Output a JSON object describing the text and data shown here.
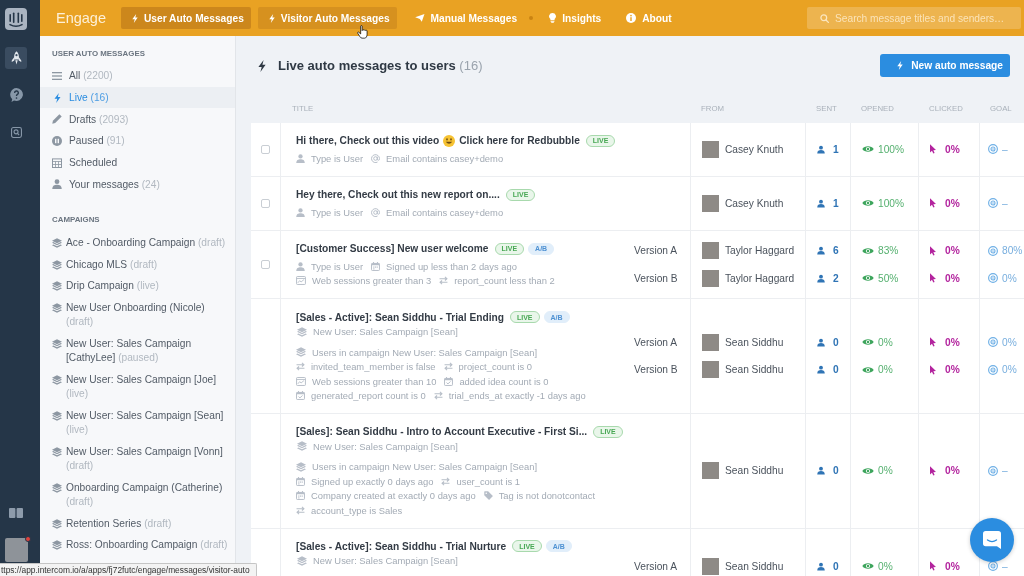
{
  "rail": {
    "items": [
      {
        "selected": true
      },
      {
        "selected": false
      },
      {
        "selected": false
      }
    ],
    "account": {
      "notification": true
    }
  },
  "topbar": {
    "product": "Engage",
    "nav": [
      {
        "kind": "tab",
        "label": "User Auto Messages",
        "selected": true,
        "hovered": false
      },
      {
        "kind": "tab",
        "label": "Visitor Auto Messages",
        "selected": false,
        "hovered": true
      },
      {
        "kind": "tab",
        "label": "Manual Messages",
        "selected": false,
        "hovered": false
      },
      {
        "kind": "dot"
      },
      {
        "kind": "tab",
        "label": "Insights",
        "selected": false,
        "hovered": false
      },
      {
        "kind": "tab",
        "label": "About",
        "selected": false,
        "hovered": false
      }
    ],
    "search": {
      "placeholder": "Search message titles and senders…"
    }
  },
  "sidebar": {
    "filters_heading": "USER AUTO MESSAGES",
    "filters": [
      {
        "label": "All",
        "count": "(2200)",
        "selected": false
      },
      {
        "label": "Live",
        "count": "(16)",
        "selected": true
      },
      {
        "label": "Drafts",
        "count": "(2093)",
        "selected": false
      },
      {
        "label": "Paused",
        "count": "(91)",
        "selected": false
      },
      {
        "label": "Scheduled",
        "selected": false
      },
      {
        "label": "Your messages",
        "count": "(24)",
        "selected": false
      }
    ],
    "campaigns_heading": "CAMPAIGNS",
    "campaigns": [
      {
        "label": "Ace - Onboarding Campaign",
        "status": "(draft)",
        "selected": false
      },
      {
        "label": "Chicago MLS",
        "status": "(draft)",
        "selected": false
      },
      {
        "label": "Drip Campaign",
        "status": "(live)",
        "selected": false
      },
      {
        "label": "New User Onboarding (Nicole)",
        "status": "(draft)",
        "selected": false
      },
      {
        "label": "New User: Sales Campaign [CathyLee]",
        "status": "(paused)",
        "selected": false
      },
      {
        "label": "New User: Sales Campaign [Joe]",
        "status": "(live)",
        "selected": false
      },
      {
        "label": "New User: Sales Campaign [Sean]",
        "status": "(live)",
        "selected": false
      },
      {
        "label": "New User: Sales Campaign [Vonn]",
        "status": "(draft)",
        "selected": false
      },
      {
        "label": "Onboarding Campaign (Catherine)",
        "status": "(draft)",
        "selected": false
      },
      {
        "label": "Retention Series",
        "status": "(draft)",
        "selected": false
      },
      {
        "label": "Ross: Onboarding Campaign",
        "status": "(draft)",
        "selected": false
      }
    ]
  },
  "main": {
    "title": "Live auto messages to users",
    "count": "(16)",
    "new_button": "New auto message"
  },
  "table": {
    "columns": [
      "TITLE",
      "FROM",
      "SENT",
      "OPENED",
      "CLICKED",
      "GOAL"
    ],
    "rows": [
      {
        "checked": false,
        "title": [
          {
            "kind": "text",
            "text": "Hi there, Check out this video"
          },
          {
            "kind": "emoji"
          },
          {
            "kind": "text",
            "text": "Click here for Redbubble"
          }
        ],
        "badges": [
          {
            "kind": "live",
            "text": "LIVE"
          }
        ],
        "conditions": [
          [
            {
              "kind": "user",
              "text": "Type is User"
            },
            {
              "kind": "email",
              "text": "Email contains casey+demo"
            }
          ]
        ],
        "stats": [
          {
            "from": "Casey Knuth",
            "sent": "1",
            "opened": "100%",
            "clicked": "0%",
            "goal": "–"
          }
        ]
      },
      {
        "checked": false,
        "title": [
          {
            "kind": "text",
            "text": "Hey there, Check out this new report on...."
          }
        ],
        "badges": [
          {
            "kind": "live",
            "text": "LIVE"
          }
        ],
        "conditions": [
          [
            {
              "kind": "user",
              "text": "Type is User"
            },
            {
              "kind": "email",
              "text": "Email contains casey+demo"
            }
          ]
        ],
        "stats": [
          {
            "from": "Casey Knuth",
            "sent": "1",
            "opened": "100%",
            "clicked": "0%",
            "goal": "–"
          }
        ]
      },
      {
        "checked": false,
        "title": [
          {
            "kind": "text",
            "text": "[Customer Success] New user welcome"
          }
        ],
        "badges": [
          {
            "kind": "live",
            "text": "LIVE"
          },
          {
            "kind": "ab",
            "text": "A/B"
          }
        ],
        "conditions": [
          [
            {
              "kind": "user",
              "text": "Type is User"
            },
            {
              "kind": "date",
              "text": "Signed up less than 2 days ago"
            }
          ],
          [
            {
              "kind": "session",
              "text": "Web sessions greater than 3"
            },
            {
              "kind": "attribute",
              "text": "report_count less than 2"
            }
          ]
        ],
        "stats": [
          {
            "version": "Version A",
            "from": "Taylor Haggard",
            "sent": "6",
            "opened": "83%",
            "clicked": "0%",
            "goal": "80%"
          },
          {
            "version": "Version B",
            "from": "Taylor Haggard",
            "sent": "2",
            "opened": "50%",
            "clicked": "0%",
            "goal": "0%"
          }
        ]
      },
      {
        "title": [
          {
            "kind": "text",
            "text": "[Sales - Active]: Sean Siddhu - Trial Ending"
          }
        ],
        "badges": [
          {
            "kind": "live",
            "text": "LIVE"
          },
          {
            "kind": "ab",
            "text": "A/B"
          }
        ],
        "campaign": "New User: Sales Campaign [Sean]",
        "conditions": [
          [
            {
              "kind": "campaign",
              "text": "Users in campaign New User: Sales Campaign [Sean]"
            }
          ],
          [
            {
              "kind": "attribute",
              "text": "invited_team_member is false"
            },
            {
              "kind": "attribute",
              "text": "project_count is 0"
            }
          ],
          [
            {
              "kind": "session",
              "text": "Web sessions greater than 10"
            },
            {
              "kind": "event",
              "text": "added idea count is 0"
            }
          ],
          [
            {
              "kind": "event",
              "text": "generated_report count is 0"
            },
            {
              "kind": "attribute",
              "text": "trial_ends_at exactly -1 days ago"
            }
          ]
        ],
        "stats": [
          {
            "version": "Version A",
            "from": "Sean Siddhu",
            "sent": "0",
            "opened": "0%",
            "clicked": "0%",
            "goal": "0%"
          },
          {
            "version": "Version B",
            "from": "Sean Siddhu",
            "sent": "0",
            "opened": "0%",
            "clicked": "0%",
            "goal": "0%"
          }
        ]
      },
      {
        "title": [
          {
            "kind": "text",
            "text": "[Sales]: Sean Siddhu - Intro to Account Executive - First Si..."
          }
        ],
        "badges": [
          {
            "kind": "live",
            "text": "LIVE"
          }
        ],
        "campaign": "New User: Sales Campaign [Sean]",
        "conditions": [
          [
            {
              "kind": "campaign",
              "text": "Users in campaign New User: Sales Campaign [Sean]"
            }
          ],
          [
            {
              "kind": "date",
              "text": "Signed up exactly 0 days ago"
            },
            {
              "kind": "attribute",
              "text": "user_count is 1"
            }
          ],
          [
            {
              "kind": "date",
              "text": "Company created at exactly 0 days ago"
            },
            {
              "kind": "tag",
              "text": "Tag is not donotcontact"
            }
          ],
          [
            {
              "kind": "attribute",
              "text": "account_type is Sales"
            }
          ]
        ],
        "stats": [
          {
            "from": "Sean Siddhu",
            "sent": "0",
            "opened": "0%",
            "clicked": "0%",
            "goal": "–"
          }
        ]
      },
      {
        "title": [
          {
            "kind": "text",
            "text": "[Sales - Active]: Sean Siddhu - Trial Nurture"
          }
        ],
        "badges": [
          {
            "kind": "live",
            "text": "LIVE"
          },
          {
            "kind": "ab",
            "text": "A/B"
          }
        ],
        "campaign": "New User: Sales Campaign [Sean]",
        "stats": [
          {
            "version": "Version A",
            "from": "Sean Siddhu",
            "sent": "0",
            "opened": "0%",
            "clicked": "0%",
            "goal": "–"
          }
        ]
      }
    ]
  },
  "status_url": "ttps://app.intercom.io/a/apps/fj72futc/engage/messages/visitor-auto"
}
